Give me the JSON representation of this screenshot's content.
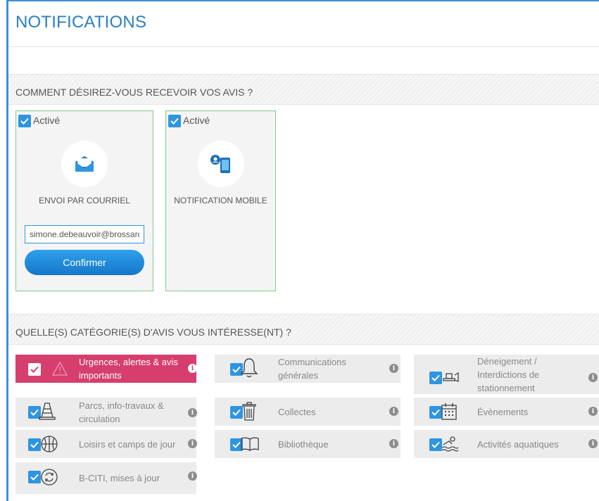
{
  "page": {
    "title": "NOTIFICATIONS"
  },
  "delivery": {
    "heading": "COMMENT DÉSIREZ-VOUS RECEVOIR VOS AVIS ?",
    "email": {
      "checked_label": "Activé",
      "name": "ENVOI PAR COURRIEL",
      "input_value": "simone.debeauvoir@brossard.ca",
      "confirm_label": "Confirmer",
      "icon": "envelope-icon"
    },
    "mobile": {
      "checked_label": "Activé",
      "name": "NOTIFICATION MOBILE",
      "icon": "mobile-phone-icon"
    }
  },
  "categories": {
    "heading": "QUELLE(S) CATÉGORIE(S) D'AVIS VOUS INTÉRESSE(NT) ?",
    "items": [
      {
        "label": "Urgences, alertes & avis importants",
        "icon": "warning-icon",
        "checked": true
      },
      {
        "label": "Communications générales",
        "icon": "bell-icon",
        "checked": true
      },
      {
        "label": "Déneigement / Interdictions de stationnement",
        "icon": "snow-plow-icon",
        "checked": true
      },
      {
        "label": "Parcs, info-travaux & circulation",
        "icon": "traffic-cone-icon",
        "checked": true
      },
      {
        "label": "Collectes",
        "icon": "trash-can-icon",
        "checked": true
      },
      {
        "label": "Évènements",
        "icon": "calendar-icon",
        "checked": true
      },
      {
        "label": "Loisirs et camps de jour",
        "icon": "basketball-icon",
        "checked": true
      },
      {
        "label": "Bibliothèque",
        "icon": "book-icon",
        "checked": true
      },
      {
        "label": "Activités aquatiques",
        "icon": "swimmer-icon",
        "checked": true
      },
      {
        "label": "B-CITI, mises à jour",
        "icon": "refresh-icon",
        "checked": true
      }
    ]
  },
  "colors": {
    "accent": "#2a7fc4",
    "checkbox": "#2f95e1",
    "urgent": "#d63e6e",
    "card_border": "#7ccf8a"
  }
}
